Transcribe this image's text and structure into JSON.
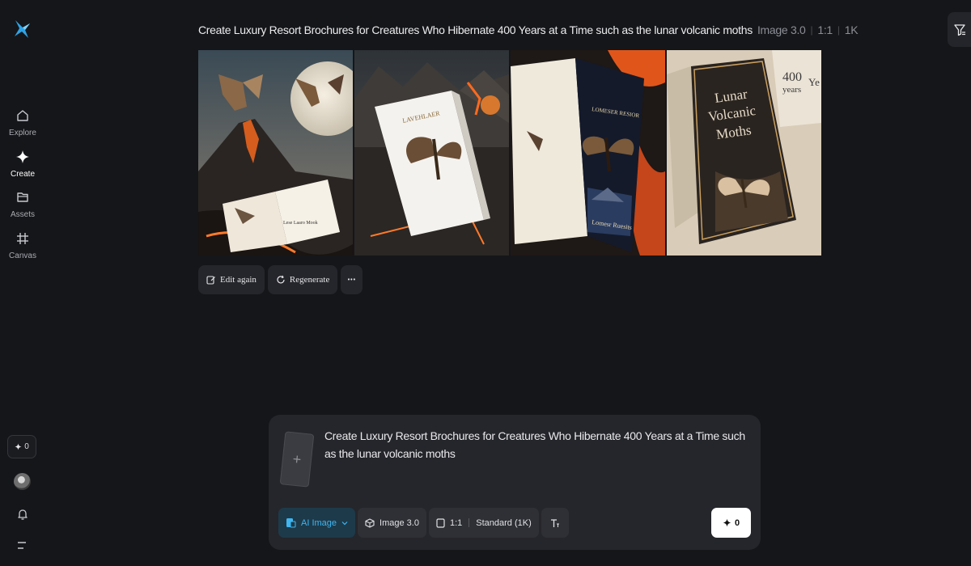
{
  "colors": {
    "accent": "#2ea3e6",
    "background": "#151619",
    "panel": "#25262b"
  },
  "sidebar": {
    "logo_icon": "dreamina-logo-icon",
    "nav": [
      {
        "label": "Explore",
        "icon": "home-icon"
      },
      {
        "label": "Create",
        "icon": "sparkle-icon"
      },
      {
        "label": "Assets",
        "icon": "folder-icon"
      },
      {
        "label": "Canvas",
        "icon": "canvas-frame-icon"
      }
    ],
    "credits": "0"
  },
  "header": {
    "prompt": "Create Luxury Resort Brochures for Creatures Who Hibernate 400 Years at a Time such as the lunar volcanic moths",
    "model": "Image 3.0",
    "ratio": "1:1",
    "resolution": "1K"
  },
  "images": [
    {
      "alt": "moths flying over erupting volcano with moon and open book"
    },
    {
      "alt": "white resort brochure with moth among volcanoes"
    },
    {
      "alt": "open dark brochure with moth on lava"
    },
    {
      "alt": "Lunar Volcanic Moths 400 years brochure"
    }
  ],
  "image_text": {
    "brochure2_title": "LAVEHLAER",
    "brochure3_title": "LOMESER RESIOR",
    "brochure3_footer": "Lomesr Ruesits",
    "brochure4_line1": "Lunar",
    "brochure4_line2": "Volcanic",
    "brochure4_line3": "Moths",
    "brochure4_number": "400",
    "brochure4_years": "years",
    "brochure4_ye": "Ye",
    "brochure1_spine": "Lese Laaro Mook"
  },
  "actions": {
    "edit_again": "Edit again",
    "regenerate": "Regenerate",
    "more": "•••"
  },
  "composer": {
    "prompt_text": "Create Luxury Resort Brochures for Creatures Who Hibernate 400 Years at a Time such as the lunar volcanic moths",
    "add_reference": "+",
    "mode": "AI Image",
    "model": "Image 3.0",
    "ratio": "1:1",
    "quality": "Standard (1K)",
    "generate_credits": "0"
  }
}
